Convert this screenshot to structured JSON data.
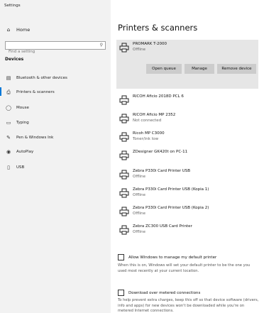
{
  "window": {
    "title": "Settings"
  },
  "sidebar": {
    "home": {
      "label": "Home",
      "icon": "home-icon"
    },
    "search": {
      "placeholder": "Find a setting"
    },
    "section": "Devices",
    "items": [
      {
        "label": "Bluetooth & other devices",
        "icon": "bluetooth-devices-icon",
        "active": false
      },
      {
        "label": "Printers & scanners",
        "icon": "printer-icon",
        "active": true
      },
      {
        "label": "Mouse",
        "icon": "mouse-icon",
        "active": false
      },
      {
        "label": "Typing",
        "icon": "keyboard-icon",
        "active": false
      },
      {
        "label": "Pen & Windows Ink",
        "icon": "pen-icon",
        "active": false
      },
      {
        "label": "AutoPlay",
        "icon": "autoplay-icon",
        "active": false
      },
      {
        "label": "USB",
        "icon": "usb-icon",
        "active": false
      }
    ]
  },
  "main": {
    "heading": "Printers & scanners",
    "selected_printer": {
      "name": "PROMARK T-2000",
      "status": "Offline",
      "buttons": {
        "open_queue": "Open queue",
        "manage": "Manage",
        "remove": "Remove device"
      }
    },
    "printers": [
      {
        "name": "RICOH Aficio 2018D PCL 6",
        "status": ""
      },
      {
        "name": "RICOH Aficio MP 2352",
        "status": "Not connected"
      },
      {
        "name": "Ricoh MP C3000",
        "status": "Toner/ink low"
      },
      {
        "name": "ZDesigner GK420t on PC-11",
        "status": ""
      },
      {
        "name": "Zebra P330i Card Printer USB",
        "status": "Offline"
      },
      {
        "name": "Zebra P330i Card Printer USB (Kopia 1)",
        "status": "Offline"
      },
      {
        "name": "Zebra P330i Card Printer USB (Kopia 2)",
        "status": "Offline"
      },
      {
        "name": "Zebra ZC300 USB Card Printer",
        "status": "Offline"
      }
    ],
    "default_printer": {
      "label": "Allow Windows to manage my default printer",
      "checked": false,
      "help": "When this is on, Windows will set your default printer to be the one you used most recently at your current location."
    },
    "metered": {
      "label": "Download over metered connections",
      "checked": false,
      "help": "To help prevent extra charges, keep this off so that device software (drivers, info and apps) for new devices won't be downloaded while you're on metered Internet connections."
    }
  }
}
